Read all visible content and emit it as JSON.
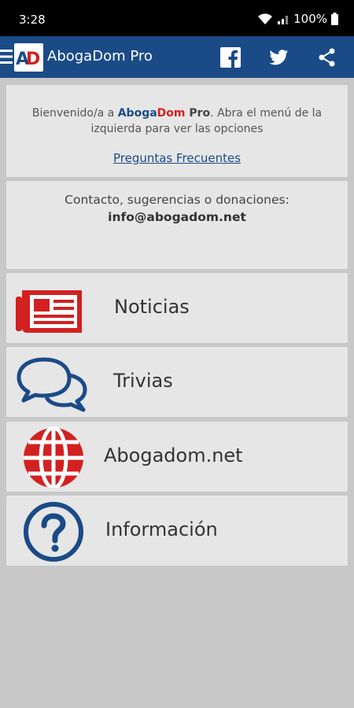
{
  "status_bar": {
    "time": "3:28",
    "battery": "100%"
  },
  "app_bar": {
    "title": "AbogaDom Pro",
    "logo_text": "AD"
  },
  "welcome": {
    "text_before": "Bienvenido/a a ",
    "brand_a": "Aboga",
    "brand_d": "Dom",
    "brand_p": " Pro",
    "text_after": ". Abra el menú de la izquierda para ver las opciones",
    "faq_link": "Preguntas Frecuentes"
  },
  "contact": {
    "label": "Contacto, sugerencias o donaciones:",
    "email": "info@abogadom.net"
  },
  "menu": [
    {
      "label": "Noticias",
      "icon": "newspaper-icon"
    },
    {
      "label": "Trivias",
      "icon": "chat-bubbles-icon"
    },
    {
      "label": "Abogadom.net",
      "icon": "globe-icon"
    },
    {
      "label": "Información",
      "icon": "question-icon"
    }
  ],
  "colors": {
    "primary": "#1a4b86",
    "accent": "#d32020",
    "panel": "#e6e6e6",
    "background": "#c8c8c8"
  }
}
